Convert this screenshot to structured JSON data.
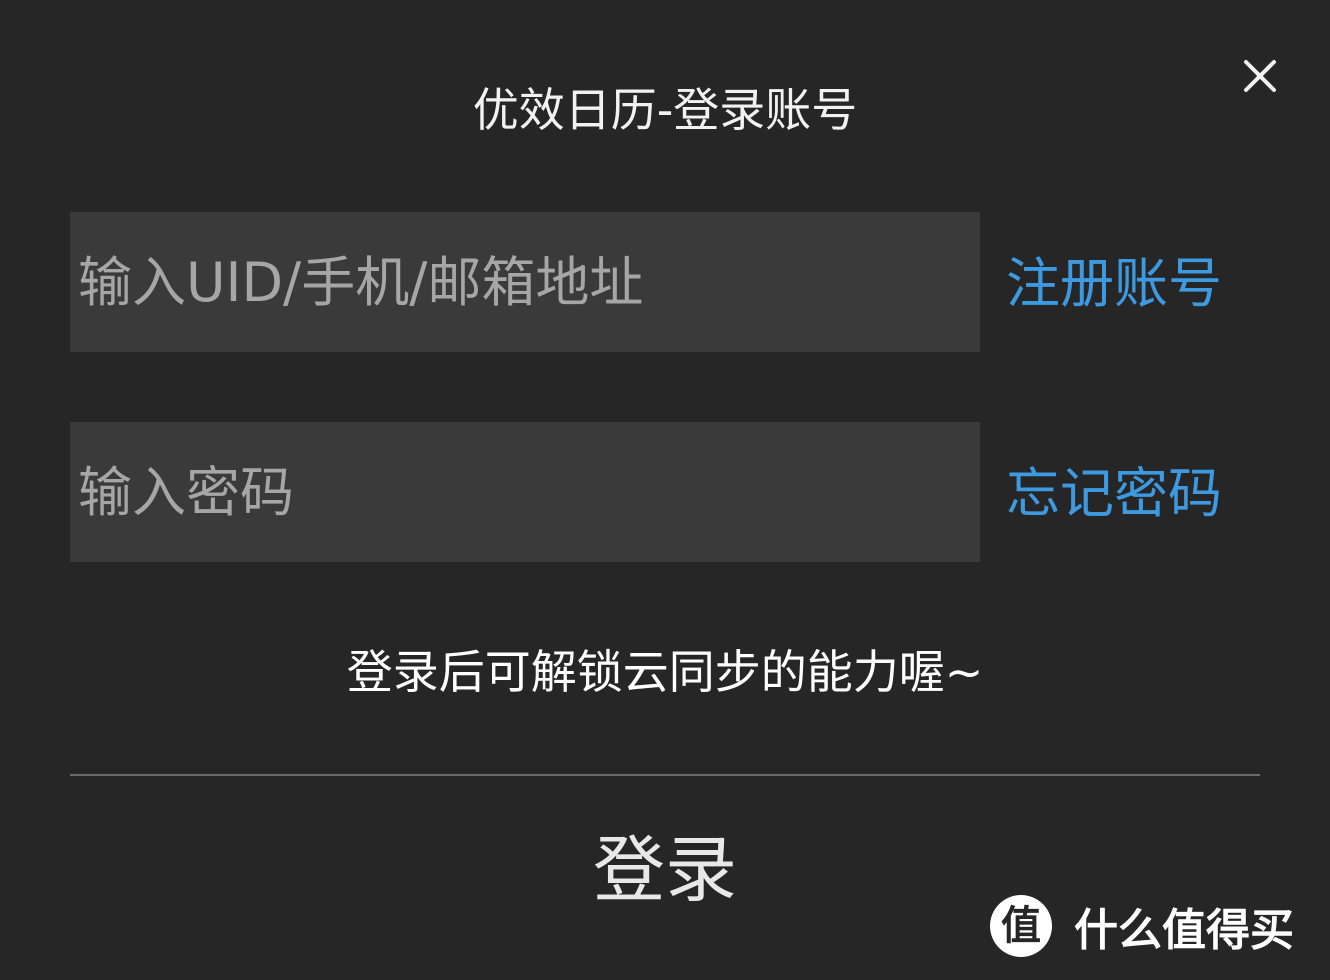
{
  "dialog": {
    "title": "优效日历-登录账号",
    "close_icon": "close-icon"
  },
  "form": {
    "account_placeholder": "输入UID/手机/邮箱地址",
    "account_value": "",
    "password_placeholder": "输入密码",
    "password_value": "",
    "register_label": "注册账号",
    "forgot_label": "忘记密码"
  },
  "hint": "登录后可解锁云同步的能力喔~",
  "login_label": "登录",
  "watermark": {
    "logo_char": "值",
    "text": "什么值得买"
  },
  "colors": {
    "background": "#262626",
    "input_background": "#3a3a3a",
    "link": "#3e9ae0",
    "text": "#f2f2f2",
    "placeholder": "#a6a6a6"
  }
}
